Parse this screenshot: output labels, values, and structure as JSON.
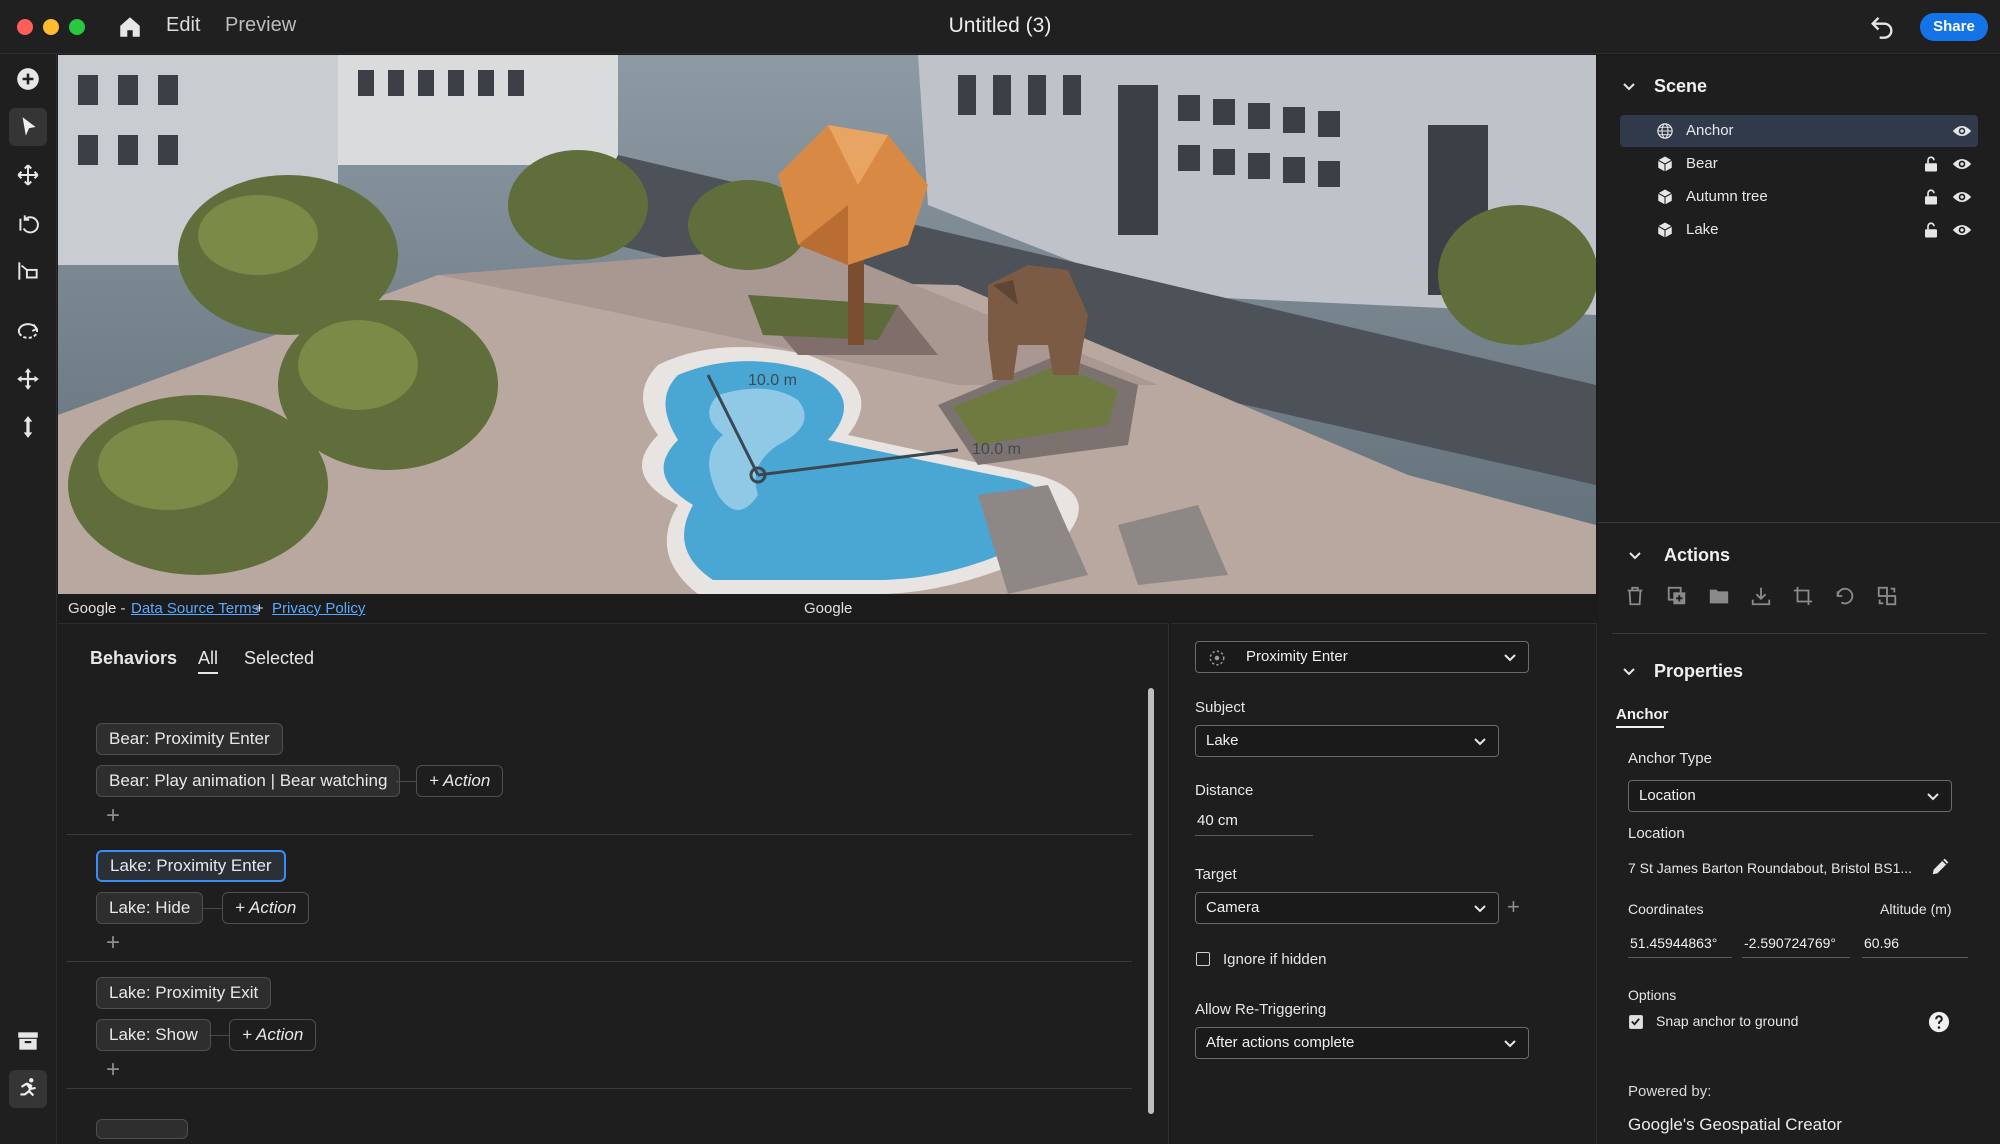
{
  "titlebar": {
    "menu_edit": "Edit",
    "menu_preview": "Preview",
    "document_title": "Untitled (3)",
    "share_label": "Share"
  },
  "viewport": {
    "measure_1": "10.0 m",
    "measure_2": "10.0 m",
    "attribution_google": "Google -",
    "data_source_terms": "Data Source Terms",
    "plus": "+",
    "privacy_policy": "Privacy Policy",
    "center_label": "Google"
  },
  "behaviors": {
    "title": "Behaviors",
    "tab_all": "All",
    "tab_selected": "Selected",
    "groups": [
      {
        "trigger": "Bear: Proximity Enter",
        "action": "Bear: Play animation | Bear watching",
        "add_action": "+ Action",
        "add": "+"
      },
      {
        "trigger": "Lake: Proximity Enter",
        "action": "Lake: Hide",
        "add_action": "+ Action",
        "add": "+"
      },
      {
        "trigger": "Lake: Proximity Exit",
        "action": "Lake: Show",
        "add_action": "+ Action",
        "add": "+"
      }
    ]
  },
  "trigger": {
    "type_value": "Proximity Enter",
    "subject_label": "Subject",
    "subject_value": "Lake",
    "distance_label": "Distance",
    "distance_value": "40 cm",
    "target_label": "Target",
    "target_value": "Camera",
    "target_add": "+",
    "ignore_hidden_label": "Ignore if hidden",
    "ignore_hidden_checked": false,
    "retrigger_label": "Allow Re-Triggering",
    "retrigger_value": "After actions complete"
  },
  "scene": {
    "title": "Scene",
    "items": [
      {
        "label": "Anchor",
        "icon": "globe-icon",
        "selected": true
      },
      {
        "label": "Bear",
        "icon": "cube-icon",
        "selected": false
      },
      {
        "label": "Autumn tree",
        "icon": "cube-icon",
        "selected": false
      },
      {
        "label": "Lake",
        "icon": "cube-icon",
        "selected": false
      }
    ]
  },
  "actions": {
    "title": "Actions",
    "icons": [
      "trash-icon",
      "duplicate-icon",
      "folder-icon",
      "download-icon",
      "crop-icon",
      "reset-icon",
      "replace-icon"
    ]
  },
  "properties": {
    "title": "Properties",
    "tab_anchor": "Anchor",
    "anchor_type_label": "Anchor Type",
    "anchor_type_value": "Location",
    "location_label": "Location",
    "location_value": "7 St James Barton Roundabout, Bristol BS1...",
    "coordinates_label": "Coordinates",
    "altitude_label": "Altitude (m)",
    "latitude": "51.45944863°",
    "longitude": "-2.590724769°",
    "altitude": "60.96",
    "options_label": "Options",
    "snap_label": "Snap anchor to ground",
    "snap_checked": true,
    "powered_by_label": "Powered by:",
    "powered_by_value": "Google's Geospatial Creator"
  },
  "colors": {
    "accent": "#1473e6",
    "selection_border": "#3b8df6",
    "link": "#5aa9ff"
  }
}
